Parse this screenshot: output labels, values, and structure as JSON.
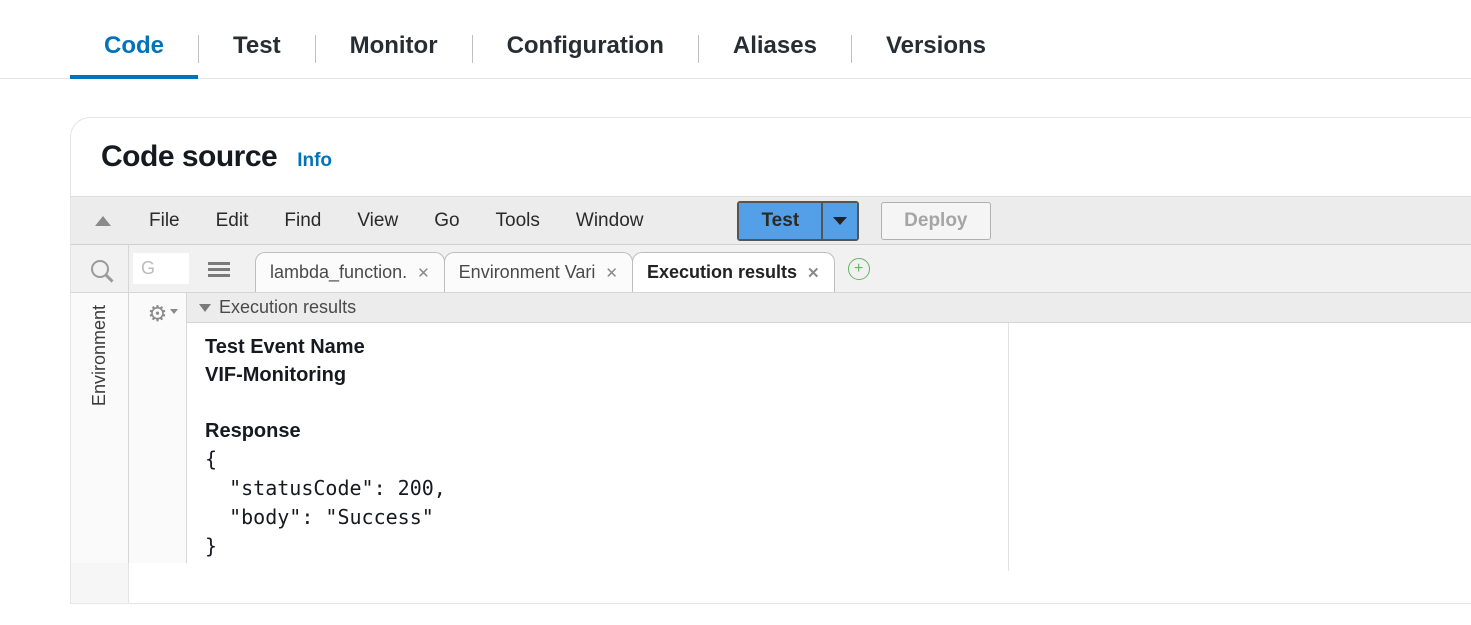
{
  "top_tabs": {
    "code": "Code",
    "test": "Test",
    "monitor": "Monitor",
    "configuration": "Configuration",
    "aliases": "Aliases",
    "versions": "Versions"
  },
  "panel": {
    "title": "Code source",
    "info": "Info"
  },
  "menu": {
    "file": "File",
    "edit": "Edit",
    "find": "Find",
    "view": "View",
    "go": "Go",
    "tools": "Tools",
    "window": "Window",
    "test_btn": "Test",
    "deploy_btn": "Deploy"
  },
  "goto_placeholder": "G",
  "file_tabs": {
    "lambda": "lambda_function.",
    "env": "Environment Vari",
    "exec": "Execution results"
  },
  "sidebar_label": "Environment",
  "results": {
    "header": "Execution results",
    "test_event_label": "Test Event Name",
    "test_event_name": "VIF-Monitoring",
    "response_label": "Response",
    "response_body": "{\n  \"statusCode\": 200,\n  \"body\": \"Success\"\n}"
  }
}
